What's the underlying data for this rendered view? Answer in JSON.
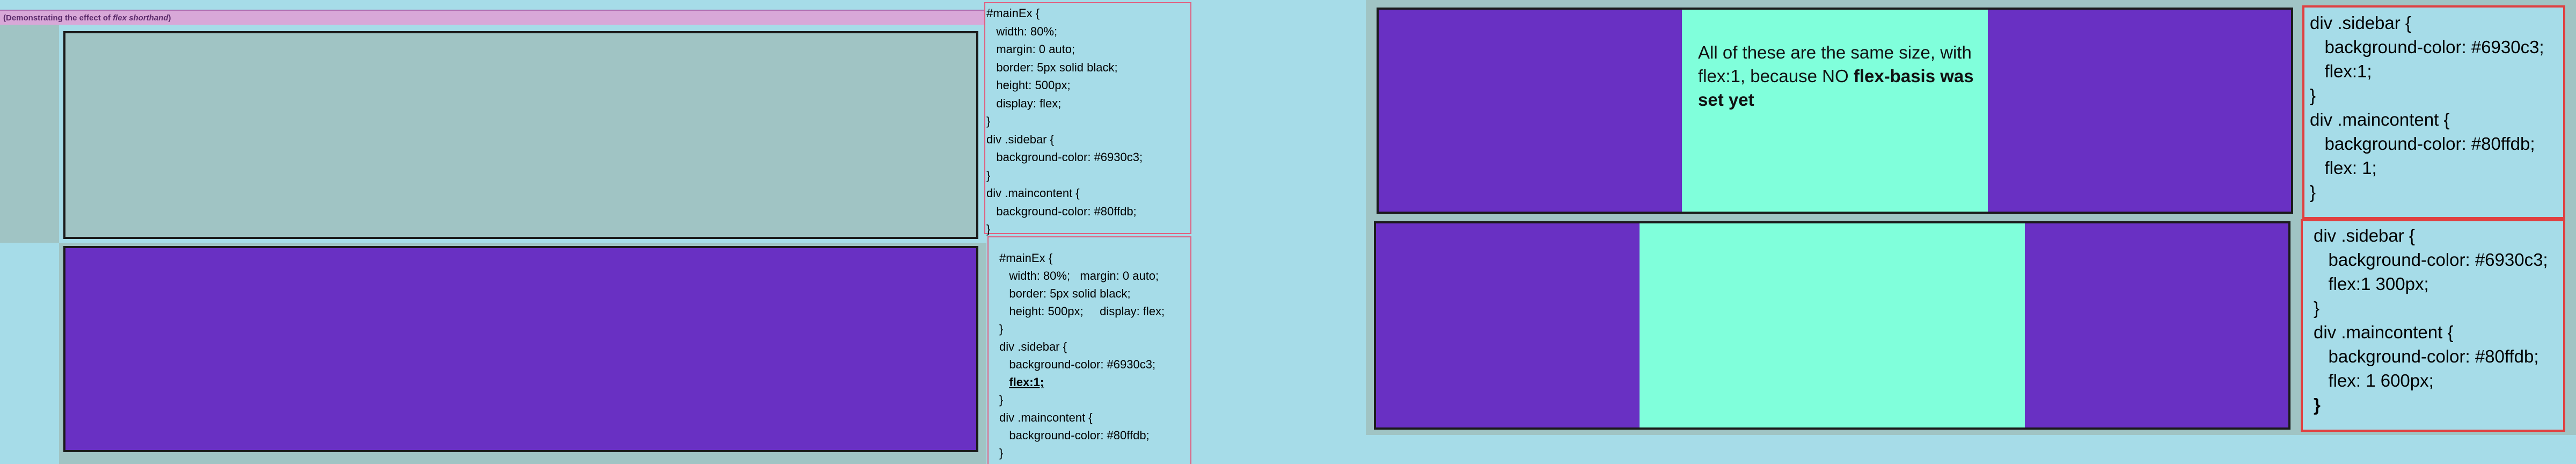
{
  "banner": {
    "prefix": "(Demonstrating the effect of ",
    "em": "flex shorthand",
    "suffix": ")"
  },
  "code1": {
    "lines": [
      "#mainEx {",
      "   width: 80%;",
      "   margin: 0 auto;",
      "   border: 5px solid black;",
      "   height: 500px;",
      "   display: flex;",
      "}",
      "div .sidebar {",
      "   background-color: #6930c3;",
      "}",
      "div .maincontent {",
      "   background-color: #80ffdb;",
      "}"
    ]
  },
  "code2": {
    "line1": "#mainEx {",
    "line2": "   width: 80%;   margin: 0 auto;",
    "line3": "   border: 5px solid black;",
    "line4": "   height: 500px;     display: flex;",
    "line5": "}",
    "line6": "div .sidebar {",
    "line7": "   background-color: #6930c3;",
    "flex_prefix": "   ",
    "flex_line": "flex:1;",
    "line9": "}",
    "line10": "div .maincontent {",
    "line11": "   background-color: #80ffdb;",
    "line12": "}"
  },
  "right_top_text": {
    "part1": "All of these are the same size, with flex:1, because NO ",
    "bold": "flex-basis was set yet"
  },
  "code3": {
    "lines": [
      "div .sidebar {",
      "   background-color: #6930c3;",
      "   flex:1;",
      "}",
      "div .maincontent {",
      "   background-color: #80ffdb;",
      "   flex: 1;",
      "}"
    ]
  },
  "code4": {
    "line1": "div .sidebar {",
    "line2": "   background-color: #6930c3;",
    "line3": "   flex:1 300px;",
    "line4": "}",
    "line5": "div .maincontent {",
    "line6": "   background-color: #80ffdb;",
    "line7": "   flex: 1 600px;",
    "last": "}"
  },
  "colors": {
    "page_bg": "#a6dce8",
    "sidebar": "#6930c3",
    "maincontent": "#80ffdb",
    "gray_panel": "#a0c4c4",
    "pink_banner": "#d8a8d8",
    "code_border_pink": "#e06080",
    "code_border_red": "#e04040"
  }
}
